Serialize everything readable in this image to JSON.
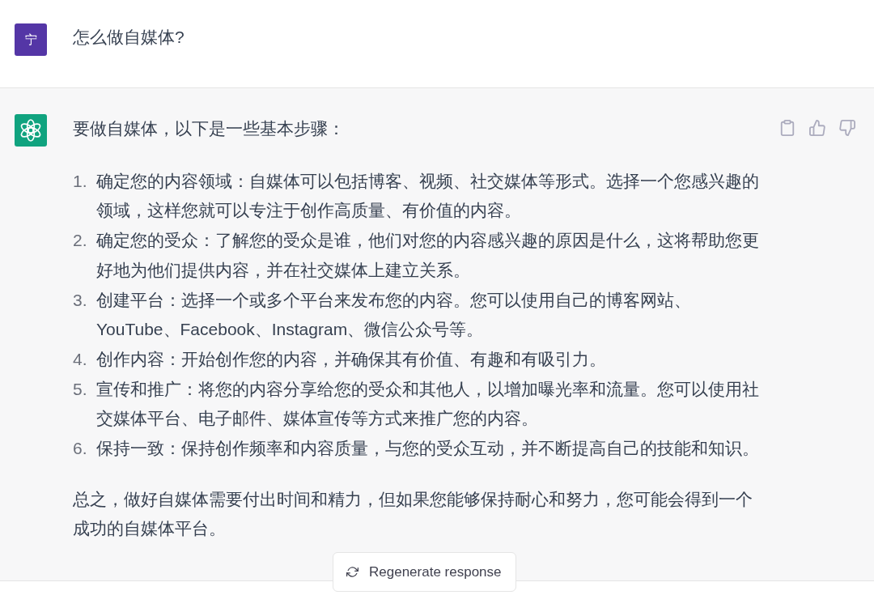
{
  "conversation": [
    {
      "kind": "user",
      "avatar": "宁",
      "text": "怎么做自媒体?"
    },
    {
      "kind": "assistant",
      "intro": "要做自媒体，以下是一些基本步骤：",
      "steps": [
        {
          "marker": "1.",
          "text": "确定您的内容领域：自媒体可以包括博客、视频、社交媒体等形式。选择一个您感兴趣的领域，这样您就可以专注于创作高质量、有价值的内容。"
        },
        {
          "marker": "2.",
          "text": "确定您的受众：了解您的受众是谁，他们对您的内容感兴趣的原因是什么，这将帮助您更好地为他们提供内容，并在社交媒体上建立关系。"
        },
        {
          "marker": "3.",
          "text": "创建平台：选择一个或多个平台来发布您的内容。您可以使用自己的博客网站、YouTube、Facebook、Instagram、微信公众号等。"
        },
        {
          "marker": "4.",
          "text": "创作内容：开始创作您的内容，并确保其有价值、有趣和有吸引力。"
        },
        {
          "marker": "5.",
          "text": "宣传和推广：将您的内容分享给您的受众和其他人，以增加曝光率和流量。您可以使用社交媒体平台、电子邮件、媒体宣传等方式来推广您的内容。"
        },
        {
          "marker": "6.",
          "text": "保持一致：保持创作频率和内容质量，与您的受众互动，并不断提高自己的技能和知识。"
        }
      ],
      "summary": "总之，做好自媒体需要付出时间和精力，但如果您能够保持耐心和努力，您可能会得到一个成功的自媒体平台。"
    }
  ],
  "regenerate_button": {
    "label": "Regenerate response"
  }
}
